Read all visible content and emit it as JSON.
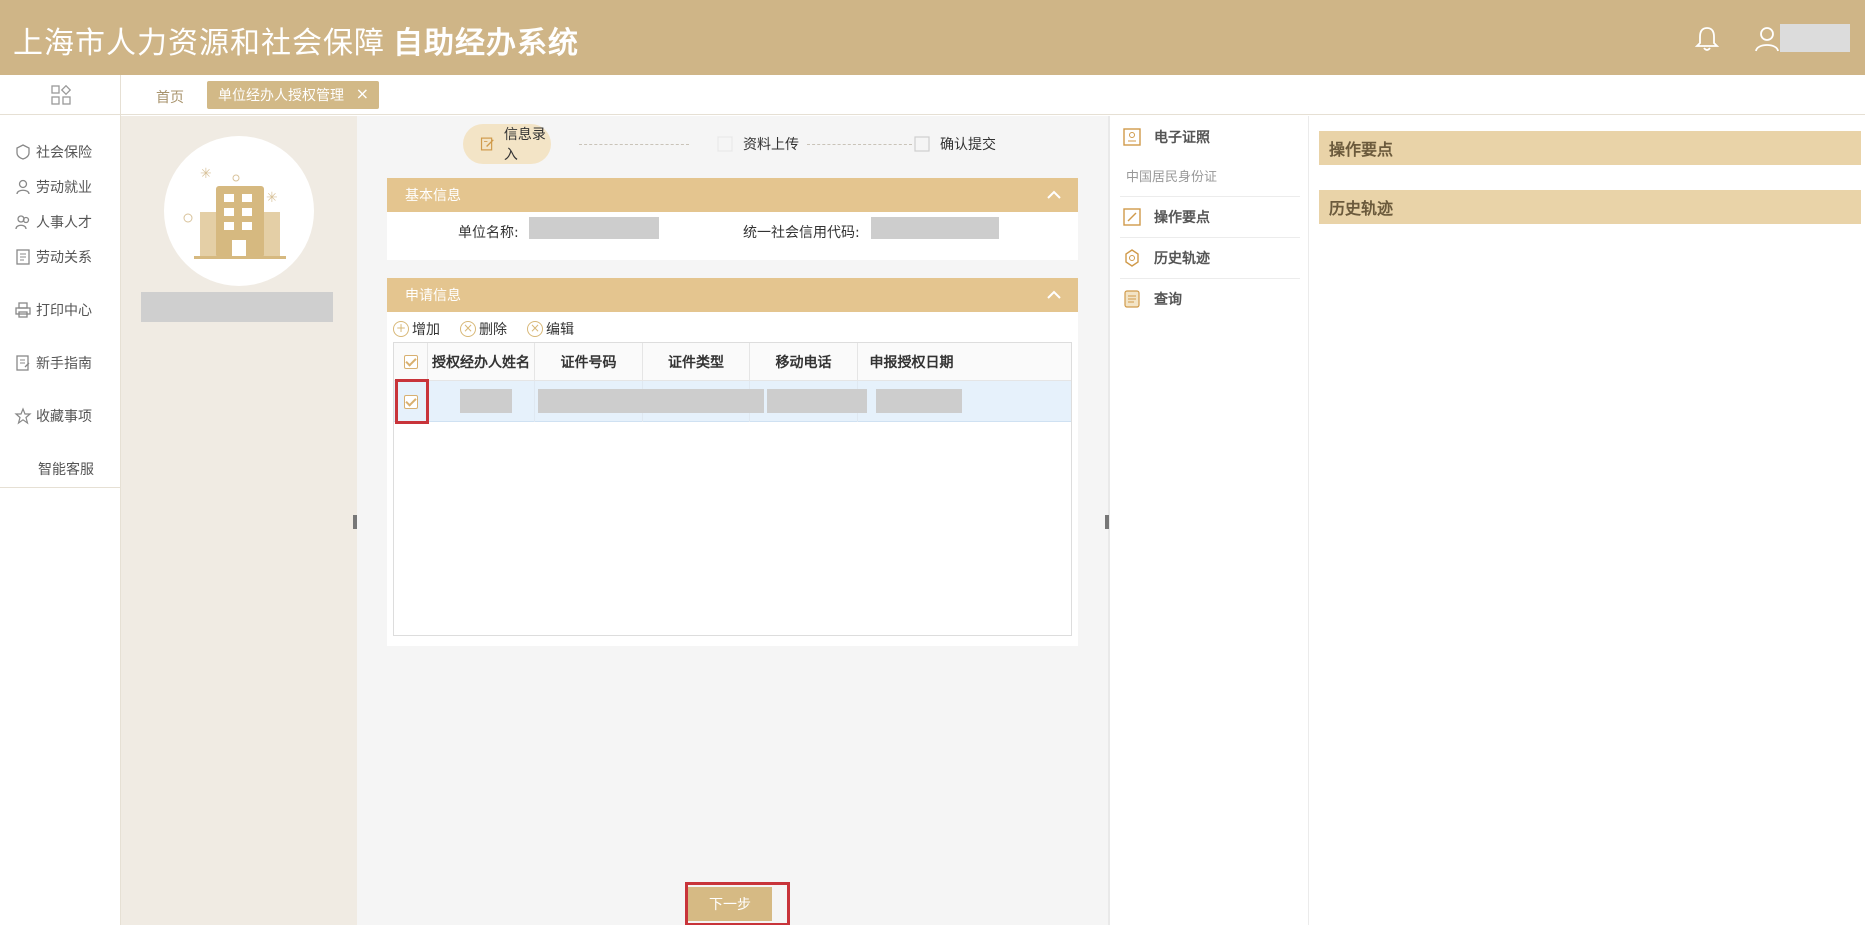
{
  "header": {
    "title_main": "上海市人力资源和社会保障",
    "title_sub": "自助经办系统"
  },
  "nav": {
    "items": [
      {
        "label": "社会保险",
        "icon": "insurance-icon"
      },
      {
        "label": "劳动就业",
        "icon": "employment-icon"
      },
      {
        "label": "人事人才",
        "icon": "personnel-icon"
      },
      {
        "label": "劳动关系",
        "icon": "labor-relations-icon"
      },
      {
        "label": "打印中心",
        "icon": "printer-icon"
      },
      {
        "label": "新手指南",
        "icon": "guide-icon"
      },
      {
        "label": "收藏事项",
        "icon": "star-icon"
      },
      {
        "label": "智能客服",
        "icon": ""
      }
    ]
  },
  "tabs": {
    "home": "首页",
    "active": "单位经办人授权管理",
    "close": "×"
  },
  "steps": [
    {
      "label": "信息录入",
      "active": true
    },
    {
      "label": "资料上传",
      "active": false
    },
    {
      "label": "确认提交",
      "active": false
    }
  ],
  "basic_info": {
    "title": "基本信息",
    "unit_name_label": "单位名称:",
    "credit_code_label": "统一社会信用代码:"
  },
  "apply_info": {
    "title": "申请信息",
    "toolbar": {
      "add": "增加",
      "delete": "删除",
      "edit": "编辑"
    },
    "columns": [
      "授权经办人姓名",
      "证件号码",
      "证件类型",
      "移动电话",
      "申报授权日期"
    ]
  },
  "next_button": "下一步",
  "right_menu": {
    "items": [
      {
        "label": "电子证照",
        "icon": "certificate-icon"
      },
      {
        "label": "操作要点",
        "icon": "operation-icon"
      },
      {
        "label": "历史轨迹",
        "icon": "history-icon"
      },
      {
        "label": "查询",
        "icon": "query-icon"
      }
    ],
    "sub_text": "中国居民身份证"
  },
  "right_panel": {
    "operation": "操作要点",
    "history": "历史轨迹"
  },
  "colors": {
    "header": "#cfb587",
    "accent": "#e4c58f",
    "row_selected": "#e6f1fb",
    "highlight": "#c8343a"
  }
}
